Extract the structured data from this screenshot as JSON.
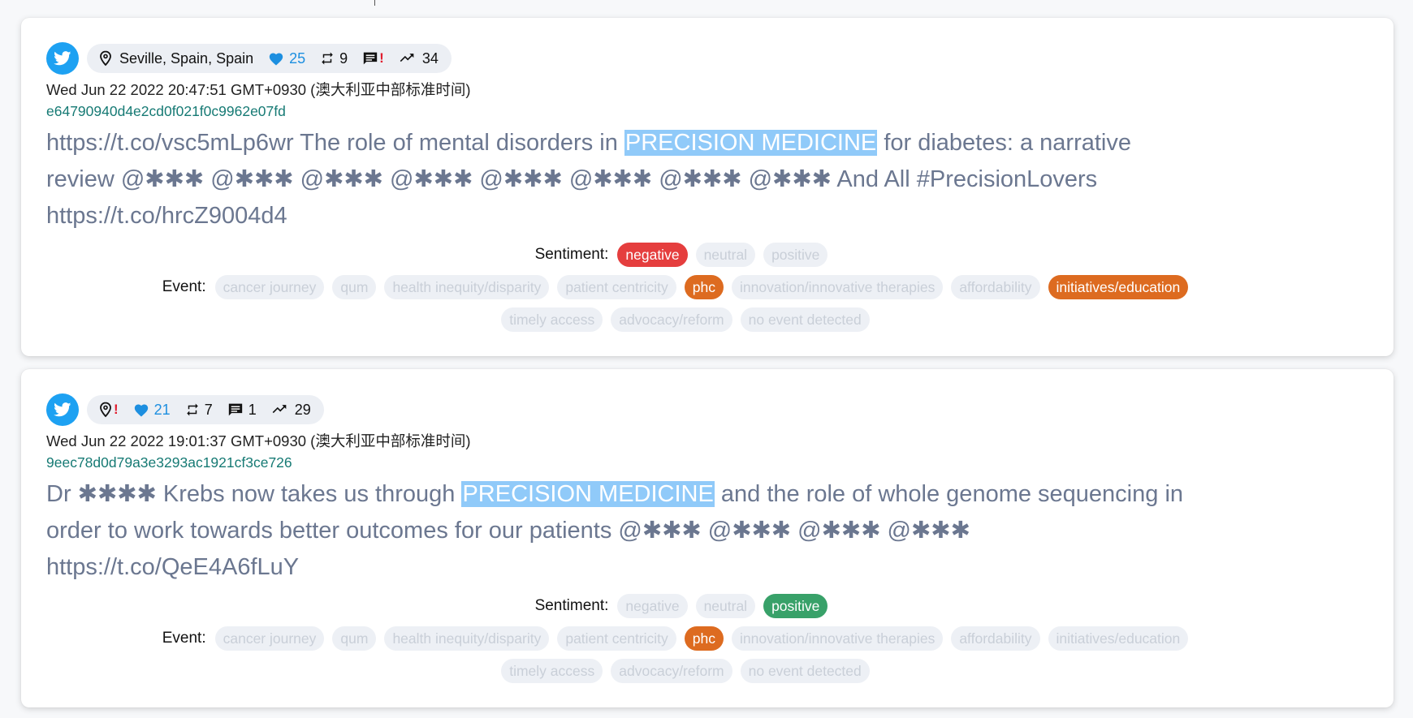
{
  "colors": {
    "twitter_blue": "#1da1f2",
    "sentiment_negative": "#e53e3e",
    "sentiment_positive": "#38a169",
    "event_selected": "#dd6b20",
    "highlight": "#90caf9"
  },
  "labels": {
    "sentiment": "Sentiment:",
    "event": "Event:"
  },
  "sentiment_options": [
    "negative",
    "neutral",
    "positive"
  ],
  "event_options": [
    "cancer journey",
    "qum",
    "health inequity/disparity",
    "patient centricity",
    "phc",
    "innovation/innovative therapies",
    "affordability",
    "initiatives/education",
    "timely access",
    "advocacy/reform",
    "no event detected"
  ],
  "tweets": [
    {
      "location": "Seville, Spain, Spain",
      "likes": "25",
      "retweets": "9",
      "replies_flag": "!",
      "engagement": "34",
      "timestamp": "Wed Jun 22 2022 20:47:51 GMT+0930 (澳大利亚中部标准时间)",
      "id": "e64790940d4e2cd0f021f0c9962e07fd",
      "text_before": "https://t.co/vsc5mLp6wr The role of mental disorders in ",
      "highlight": "PRECISION MEDICINE",
      "text_after": " for diabetes: a narrative review @✱✱✱ @✱✱✱ @✱✱✱ @✱✱✱ @✱✱✱ @✱✱✱ @✱✱✱ @✱✱✱ And All #PrecisionLovers https://t.co/hrcZ9004d4",
      "sentiment": "negative",
      "events": [
        "phc",
        "initiatives/education"
      ]
    },
    {
      "location_flag": "!",
      "likes": "21",
      "retweets": "7",
      "replies": "1",
      "engagement": "29",
      "timestamp": "Wed Jun 22 2022 19:01:37 GMT+0930 (澳大利亚中部标准时间)",
      "id": "9eec78d0d79a3e3293ac1921cf3ce726",
      "text_before": "Dr ✱✱✱✱ Krebs now takes us through ",
      "highlight": "PRECISION MEDICINE",
      "text_after": " and the role of whole genome sequencing in order to work towards better outcomes for our patients @✱✱✱ @✱✱✱ @✱✱✱ @✱✱✱ https://t.co/QeE4A6fLuY",
      "sentiment": "positive",
      "events": [
        "phc"
      ]
    }
  ]
}
